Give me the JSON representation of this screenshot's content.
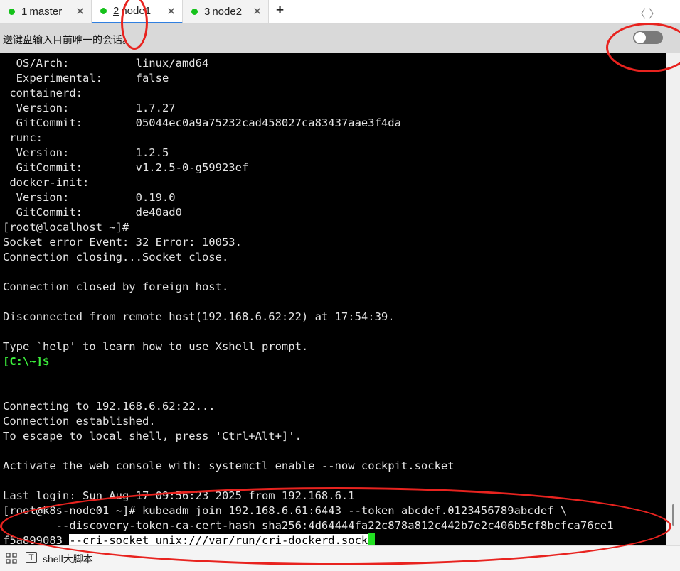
{
  "tabs": [
    {
      "num": "1",
      "label": "master",
      "close": "✕",
      "active": false
    },
    {
      "num": "2",
      "label": "node1",
      "close": "✕",
      "active": true
    },
    {
      "num": "3",
      "label": "node2",
      "close": "✕",
      "active": false
    }
  ],
  "new_tab": "+",
  "nav": {
    "prev": "〈",
    "next": "〉"
  },
  "broadcast": {
    "label": "送键盘输入目前唯一的会话。",
    "enabled": false
  },
  "terminal": {
    "lines": [
      "  OS/Arch:          linux/amd64",
      "  Experimental:     false",
      " containerd:",
      "  Version:          1.7.27",
      "  GitCommit:        05044ec0a9a75232cad458027ca83437aae3f4da",
      " runc:",
      "  Version:          1.2.5",
      "  GitCommit:        v1.2.5-0-g59923ef",
      " docker-init:",
      "  Version:          0.19.0",
      "  GitCommit:        de40ad0",
      "[root@localhost ~]#",
      "Socket error Event: 32 Error: 10053.",
      "Connection closing...Socket close.",
      "",
      "Connection closed by foreign host.",
      "",
      "Disconnected from remote host(192.168.6.62:22) at 17:54:39.",
      "",
      "Type `help' to learn how to use Xshell prompt.",
      "",
      "",
      "Connecting to 192.168.6.62:22...",
      "Connection established.",
      "To escape to local shell, press 'Ctrl+Alt+]'.",
      "",
      "Activate the web console with: systemctl enable --now cockpit.socket",
      "",
      "Last login: Sun Aug 17 09:56:23 2025 from 192.168.6.1",
      "[root@k8s-node01 ~]# kubeadm join 192.168.6.61:6443 --token abcdef.0123456789abcdef \\",
      "        --discovery-token-ca-cert-hash sha256:4d64444fa22c878a812c442b7e2c406b5cf8bcfca76ce1"
    ],
    "local_prompt": "[C:\\~]$",
    "last_line_prefix": "f5a899083 ",
    "last_line_highlight": "--cri-socket unix:///var/run/cri-dockerd.sock"
  },
  "bottom": {
    "label": "shell大脚本"
  },
  "colors": {
    "terminal_bg": "#000000",
    "prompt_green": "#3cf03c",
    "annotation_red": "#e8231f",
    "status_dot": "#15c21b"
  }
}
